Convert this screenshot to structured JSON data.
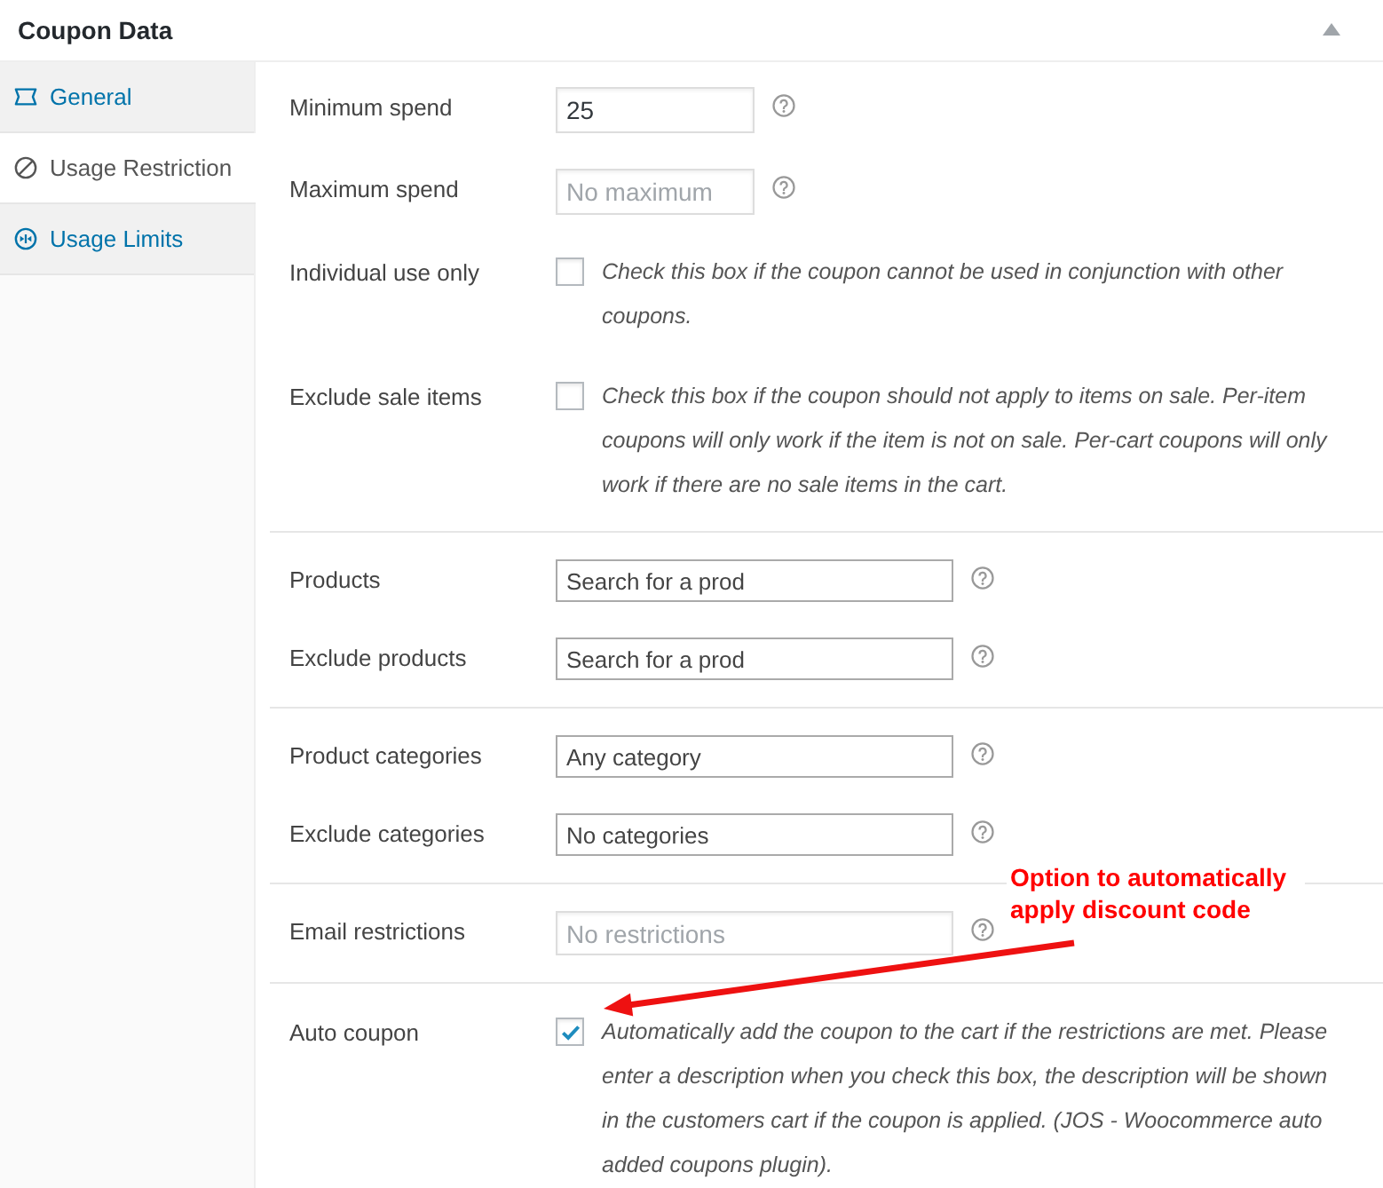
{
  "panel": {
    "title": "Coupon Data",
    "expanded": true
  },
  "tabs": [
    {
      "label": "General",
      "selected": false
    },
    {
      "label": "Usage Restriction",
      "selected": true
    },
    {
      "label": "Usage Limits",
      "selected": false
    }
  ],
  "sections": [
    {
      "fields": [
        {
          "kind": "number",
          "label": "Minimum spend",
          "value": "25"
        },
        {
          "kind": "number",
          "label": "Maximum spend",
          "placeholder": "No maximum"
        },
        {
          "kind": "checkbox",
          "label": "Individual use only",
          "checked": false,
          "description": "Check this box if the coupon cannot be used in conjunction with other coupons."
        },
        {
          "kind": "checkbox",
          "label": "Exclude sale items",
          "checked": false,
          "description": "Check this box if the coupon should not apply to items on sale. Per-item coupons will only work if the item is not on sale. Per-cart coupons will only work if there are no sale items in the cart."
        }
      ]
    },
    {
      "fields": [
        {
          "kind": "select",
          "label": "Products",
          "placeholder": "Search for a prod"
        },
        {
          "kind": "select",
          "label": "Exclude products",
          "placeholder": "Search for a prod"
        }
      ]
    },
    {
      "fields": [
        {
          "kind": "select",
          "label": "Product categories",
          "placeholder": "Any category"
        },
        {
          "kind": "select",
          "label": "Exclude categories",
          "placeholder": "No categories"
        }
      ]
    },
    {
      "fields": [
        {
          "kind": "text",
          "label": "Email restrictions",
          "placeholder": "No restrictions"
        }
      ]
    },
    {
      "fields": [
        {
          "kind": "checkbox",
          "label": "Auto coupon",
          "checked": true,
          "description": "Automatically add the coupon to the cart if the restrictions are met. Please enter a description when you check this box, the description will be shown in the customers cart if the coupon is applied. (JOS - Woocommerce auto added coupons plugin)."
        }
      ]
    }
  ],
  "annotation": {
    "text": "Option to automatically apply discount code"
  }
}
